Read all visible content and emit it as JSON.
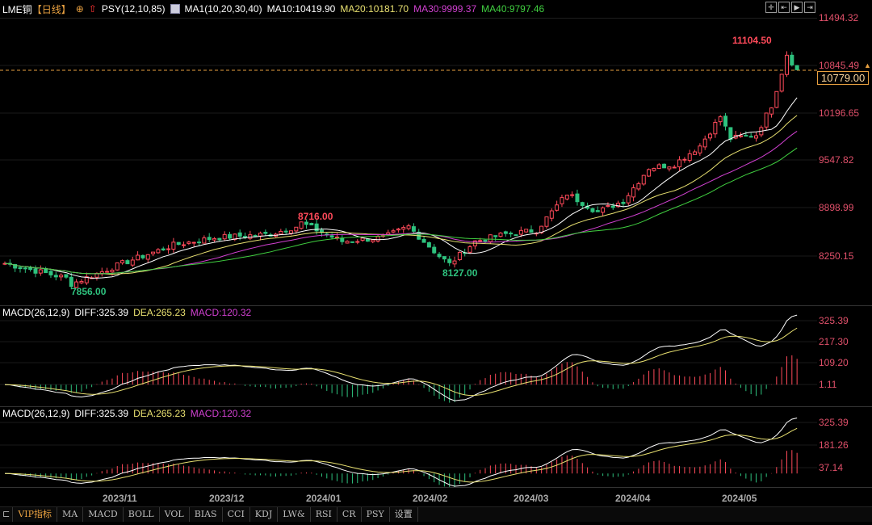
{
  "header": {
    "symbol": "LME铜",
    "period": "【日线】",
    "indicator": "PSY(12,10,85)",
    "ma_name": "MA1(10,20,30,40)",
    "ma10": "MA10:10419.90",
    "ma20": "MA20:10181.70",
    "ma30": "MA30:9999.37",
    "ma40": "MA40:9797.46"
  },
  "price_axis": [
    "11494.32",
    "10845.49",
    "10196.65",
    "9547.82",
    "8898.99",
    "8250.15"
  ],
  "last_price": "10779.00",
  "annotations": {
    "high": "11104.50",
    "low": "7856.00",
    "mid_high": "8716.00",
    "mid_low": "8127.00"
  },
  "macd1": {
    "label": "MACD(26,12,9)",
    "diff": "DIFF:325.39",
    "dea": "DEA:265.23",
    "macd": "MACD:120.32",
    "axis": [
      "325.39",
      "217.30",
      "109.20",
      "1.11"
    ]
  },
  "macd2": {
    "label": "MACD(26,12,9)",
    "diff": "DIFF:325.39",
    "dea": "DEA:265.23",
    "macd": "MACD:120.32",
    "axis": [
      "325.39",
      "181.26",
      "37.14"
    ]
  },
  "dates": [
    "2023/11",
    "2023/12",
    "2024/01",
    "2024/02",
    "2024/03",
    "2024/04",
    "2024/05"
  ],
  "tabs": [
    "VIP指标",
    "MA",
    "MACD",
    "BOLL",
    "VOL",
    "BIAS",
    "CCI",
    "KDJ",
    "LW&",
    "RSI",
    "CR",
    "PSY",
    "设置"
  ],
  "colors": {
    "up": "#ff4a5a",
    "down": "#2ec27e",
    "ma10": "#ffffff",
    "ma20": "#e8e070",
    "ma30": "#d040d0",
    "ma40": "#40d040"
  },
  "chart_data": {
    "type": "candlestick",
    "price_path": [
      [
        0,
        8150
      ],
      [
        12,
        7950
      ],
      [
        13,
        7870
      ],
      [
        23,
        8150
      ],
      [
        33,
        8400
      ],
      [
        41,
        8500
      ],
      [
        52,
        8550
      ],
      [
        57,
        8650
      ],
      [
        58,
        8700
      ],
      [
        66,
        8450
      ],
      [
        74,
        8500
      ],
      [
        79,
        8650
      ],
      [
        85,
        8250
      ],
      [
        87,
        8140
      ],
      [
        92,
        8450
      ],
      [
        98,
        8550
      ],
      [
        104,
        8600
      ],
      [
        110,
        9100
      ],
      [
        116,
        8850
      ],
      [
        121,
        9000
      ],
      [
        126,
        9450
      ],
      [
        131,
        9500
      ],
      [
        136,
        9750
      ],
      [
        140,
        10150
      ],
      [
        142,
        9850
      ],
      [
        147,
        9900
      ],
      [
        150,
        10300
      ],
      [
        152,
        10750
      ],
      [
        153,
        11000
      ],
      [
        155,
        10779
      ]
    ]
  }
}
